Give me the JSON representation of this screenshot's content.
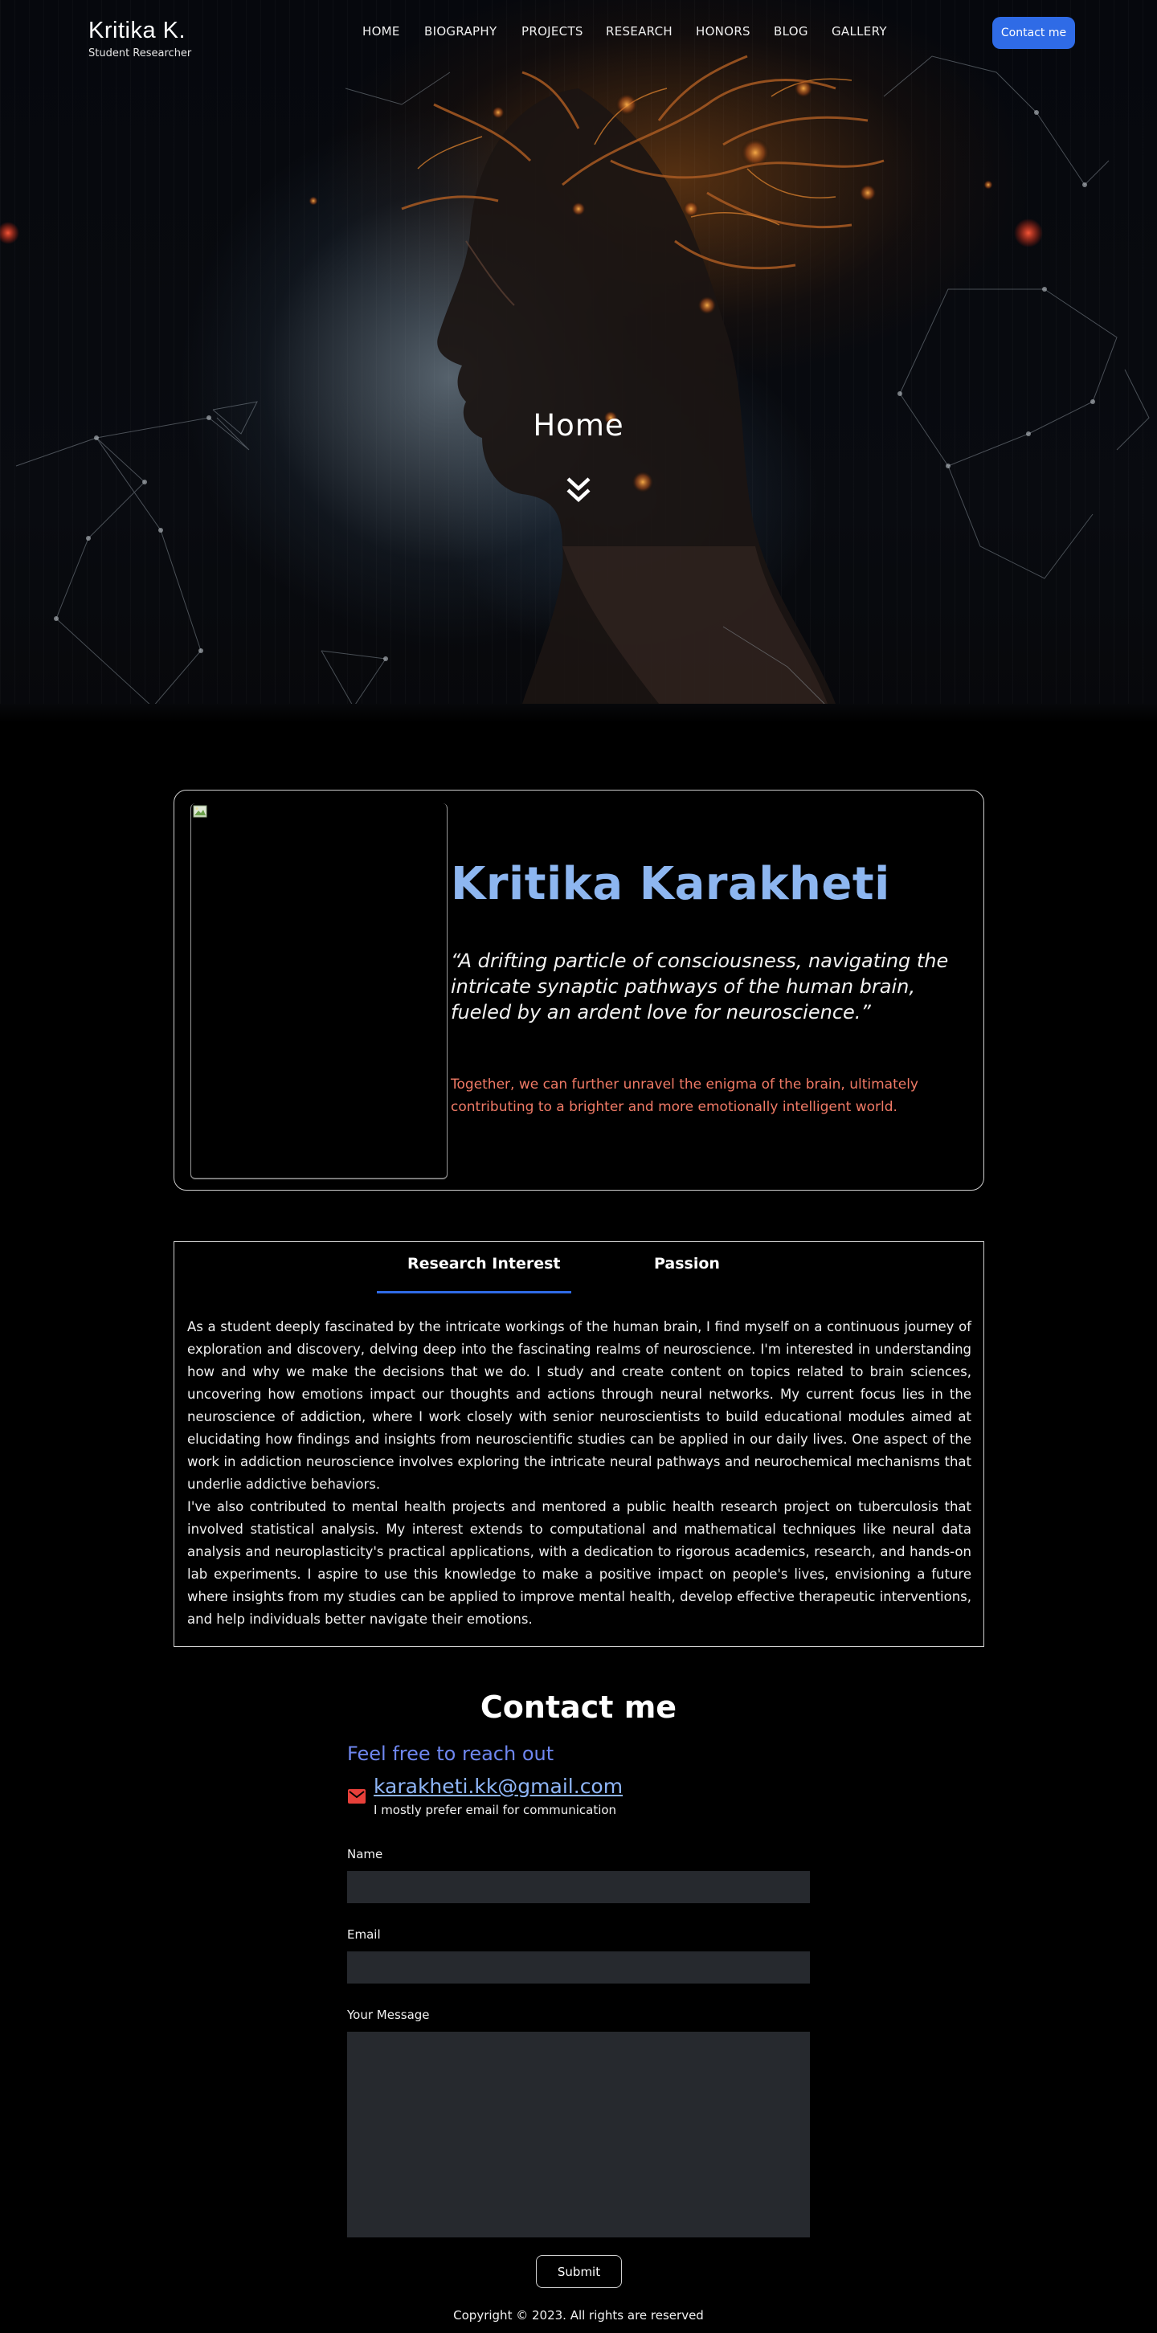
{
  "brand": {
    "name": "Kritika K.",
    "subtitle": "Student Researcher"
  },
  "nav": {
    "items": [
      "HOME",
      "BIOGRAPHY",
      "PROJECTS",
      "RESEARCH",
      "HONORS",
      "BLOG",
      "GALLERY"
    ],
    "cta": "Contact me"
  },
  "hero": {
    "title": "Home",
    "scroll_icon": "double-chevron-down-icon"
  },
  "profile": {
    "name": "Kritika Karakheti",
    "quote": "“A drifting particle of consciousness, navigating the intricate synaptic pathways of the human brain, fueled by an ardent love for neuroscience.”",
    "tagline": "Together, we can further unravel the enigma of the brain, ultimately contributing to a brighter and more emotionally intelligent world."
  },
  "tabs": {
    "items": [
      "Research Interest",
      "Passion"
    ],
    "active": "Research Interest",
    "paragraphs": [
      "As a student deeply fascinated by the intricate workings of the human brain, I find myself on a continuous journey of exploration and discovery, delving deep into the fascinating realms of neuroscience. I'm interested in understanding how and why we make the decisions that we do. I study and create content on topics related to brain sciences, uncovering how emotions impact our thoughts and actions through neural networks. My current focus lies in the neuroscience of addiction, where I work closely with senior neuroscientists to build educational modules aimed at elucidating how findings and insights from neuroscientific studies can be applied in our daily lives. One aspect of the work in addiction neuroscience involves exploring the intricate neural pathways and neurochemical mechanisms that underlie addictive behaviors.",
      "I've also contributed to mental health projects and mentored a public health research project on tuberculosis that involved statistical analysis. My interest extends to computational and mathematical techniques like neural data analysis and neuroplasticity's practical applications, with a dedication to rigorous academics, research, and hands-on lab experiments. I aspire to use this knowledge to make a positive impact on people's lives, envisioning a future where insights from my studies can be applied to improve mental health, develop effective therapeutic interventions, and help individuals better navigate their emotions."
    ]
  },
  "contact": {
    "title": "Contact me",
    "subtitle": "Feel free to reach out",
    "email": "karakheti.kk@gmail.com",
    "note": "I mostly prefer email for communication",
    "fields": {
      "name_label": "Name",
      "name_value": "",
      "email_label": "Email",
      "email_value": "",
      "message_label": "Your Message",
      "message_value": ""
    },
    "submit": "Submit"
  },
  "footer": {
    "copyright": "Copyright © 2023. All rights are reserved"
  },
  "colors": {
    "accent": "#2f6be6",
    "name": "#8db6f0",
    "tagline": "#f07a66",
    "subtitle": "#6f87f0",
    "mail_icon": "#e8403a"
  }
}
